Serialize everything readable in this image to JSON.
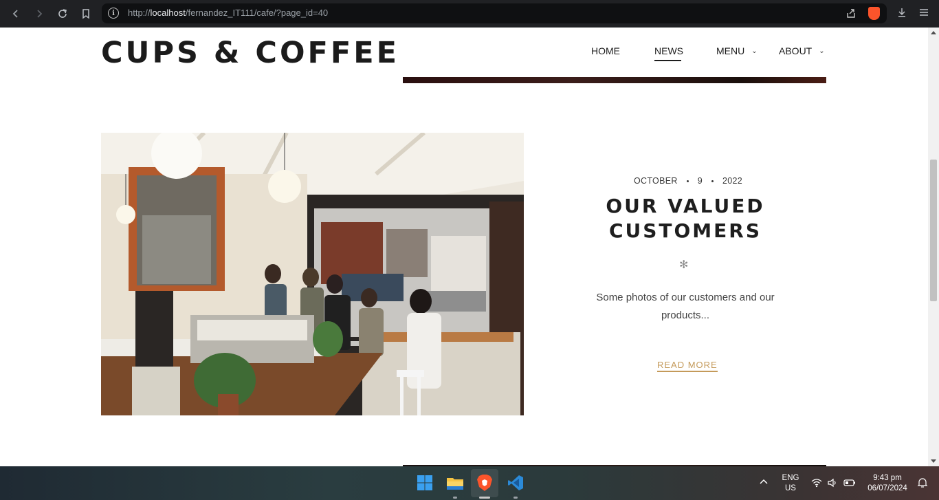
{
  "browser": {
    "url_prefix": "http://",
    "url_host": "localhost",
    "url_path": "/fernandez_IT111/cafe/?page_id=40",
    "info_glyph": "i"
  },
  "site": {
    "title": "CUPS & COFFEE",
    "nav": [
      {
        "label": "HOME",
        "active": false,
        "has_dropdown": false
      },
      {
        "label": "NEWS",
        "active": true,
        "has_dropdown": false
      },
      {
        "label": "MENU",
        "active": false,
        "has_dropdown": true
      },
      {
        "label": "ABOUT",
        "active": false,
        "has_dropdown": true
      }
    ]
  },
  "post": {
    "date_month": "OCTOBER",
    "date_day": "9",
    "date_year": "2022",
    "title": "OUR VALUED CUSTOMERS",
    "ornament": "✻",
    "excerpt": "Some photos of our customers and our products...",
    "read_more": "READ MORE",
    "photo_icon": "cafe-interior-photo"
  },
  "taskbar": {
    "language_line1": "ENG",
    "language_line2": "US",
    "time": "9:43 pm",
    "date": "06/07/2024"
  },
  "colors": {
    "accent": "#c49a5a",
    "text_dark": "#1e1e1e",
    "browser_bg": "#202124"
  }
}
